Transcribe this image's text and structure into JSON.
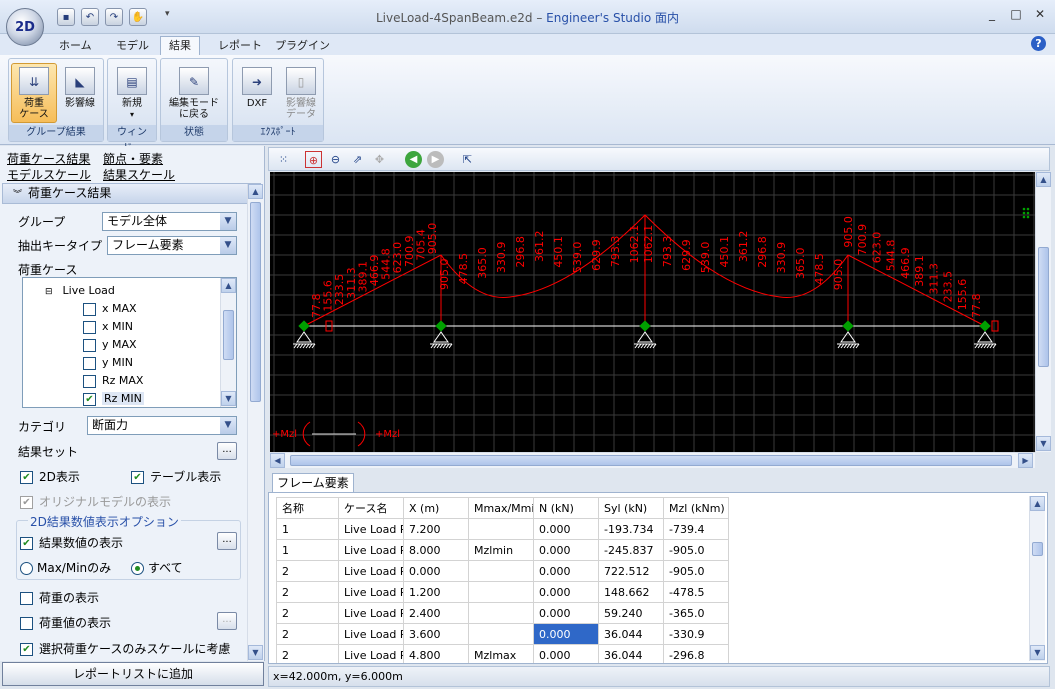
{
  "app": {
    "title_file": "LiveLoad-4SpanBeam.e2d",
    "title_sep": " – ",
    "title_brand": "Engineer's Studio 面内",
    "logo_text": "2D"
  },
  "window_controls": {
    "minimize": "_",
    "maximize": "□",
    "close": "✕"
  },
  "tabs": [
    "ホーム",
    "モデル",
    "結果",
    "レポート",
    "プラグイン"
  ],
  "active_tab": 2,
  "ribbon": {
    "groups": [
      {
        "caption": "グループ結果",
        "buttons": [
          {
            "label": "荷重\nケース",
            "icon": "load-case-icon",
            "active": true
          },
          {
            "label": "影響線",
            "icon": "influence-line-icon"
          }
        ]
      },
      {
        "caption": "ウィンド...",
        "buttons": [
          {
            "label": "新規",
            "icon": "new-window-icon"
          }
        ]
      },
      {
        "caption": "状態",
        "buttons": [
          {
            "label": "編集モード\nに戻る",
            "icon": "edit-mode-icon"
          }
        ]
      },
      {
        "caption": "ｴｸｽﾎﾟｰﾄ",
        "buttons": [
          {
            "label": "DXF",
            "icon": "dxf-export-icon"
          },
          {
            "label": "影響線\nデータ",
            "icon": "influence-data-icon",
            "disabled": true
          }
        ]
      }
    ]
  },
  "left": {
    "links": [
      "荷重ケース結果",
      "節点・要素",
      "モデルスケール",
      "結果スケール"
    ],
    "section_title": "荷重ケース結果",
    "group_label": "グループ",
    "group_value": "モデル全体",
    "extract_label": "抽出キータイプ",
    "extract_value": "フレーム要素",
    "loadcase_label": "荷重ケース",
    "tree_root": "Live Load",
    "tree_items": [
      {
        "label": "x MAX",
        "checked": false
      },
      {
        "label": "x MIN",
        "checked": false
      },
      {
        "label": "y MAX",
        "checked": false
      },
      {
        "label": "y MIN",
        "checked": false
      },
      {
        "label": "Rz MAX",
        "checked": false
      },
      {
        "label": "Rz MIN",
        "checked": true
      }
    ],
    "category_label": "カテゴリ",
    "category_value": "断面力",
    "result_set_label": "結果セット",
    "ellipsis": "...",
    "show2d": "2D表示",
    "show_table": "テーブル表示",
    "show_original": "オリジナルモデルの表示",
    "options_title": "2D結果数値表示オプション",
    "show_values": "結果数値の表示",
    "radio_maxmin": "Max/Minのみ",
    "radio_all": "すべて",
    "show_load": "荷重の表示",
    "show_load_values": "荷重値の表示",
    "scale_selected": "選択荷重ケースのみスケールに考慮",
    "add_report": "レポートリストに追加"
  },
  "canvas": {
    "left_moment_label": "+Mzl",
    "right_moment_label": "+Mzl",
    "labels_left": [
      "77.8",
      "155.6",
      "233.5",
      "311.3",
      "389.1",
      "466.9",
      "544.8",
      "623.0",
      "700.9",
      "705.4",
      "905.0"
    ],
    "labels_mid1": [
      "905.0",
      "478.5",
      "365.0",
      "330.9",
      "296.8",
      "361.2",
      "450.1",
      "539.0",
      "629.9",
      "793.3",
      "1062.1"
    ],
    "labels_mid2": [
      "1062.1",
      "793.3",
      "629.9",
      "539.0",
      "450.1",
      "361.2",
      "296.8",
      "330.9",
      "365.0",
      "478.5",
      "905.0"
    ],
    "labels_right": [
      "905.0",
      "700.9",
      "623.0",
      "544.8",
      "466.9",
      "389.1",
      "311.3",
      "233.5",
      "155.6",
      "77.8"
    ]
  },
  "table": {
    "tab_label": "フレーム要素",
    "columns": [
      "名称",
      "ケース名",
      "X (m)",
      "Mmax/Mmin",
      "N (kN)",
      "Syl (kN)",
      "Mzl (kNm)"
    ],
    "rows": [
      [
        "1",
        "Live Load Rz",
        "7.200",
        "",
        "0.000",
        "-193.734",
        "-739.4"
      ],
      [
        "1",
        "Live Load Rz",
        "8.000",
        "Mzlmin",
        "0.000",
        "-245.837",
        "-905.0"
      ],
      [
        "2",
        "Live Load Rz",
        "0.000",
        "",
        "0.000",
        "722.512",
        "-905.0"
      ],
      [
        "2",
        "Live Load Rz",
        "1.200",
        "",
        "0.000",
        "148.662",
        "-478.5"
      ],
      [
        "2",
        "Live Load Rz",
        "2.400",
        "",
        "0.000",
        "59.240",
        "-365.0"
      ],
      [
        "2",
        "Live Load Rz",
        "3.600",
        "",
        "0.000",
        "36.044",
        "-330.9"
      ],
      [
        "2",
        "Live Load Rz",
        "4.800",
        "Mzlmax",
        "0.000",
        "36.044",
        "-296.8"
      ]
    ],
    "selected_cell": [
      5,
      4
    ]
  },
  "status": {
    "coords": "x=42.000m, y=6.000m"
  },
  "colors": {
    "diagram": "#ff0000",
    "grid": "#3a3a3a",
    "support": "#ffffff",
    "node": "#00a000",
    "selection": "#2f68c8"
  }
}
